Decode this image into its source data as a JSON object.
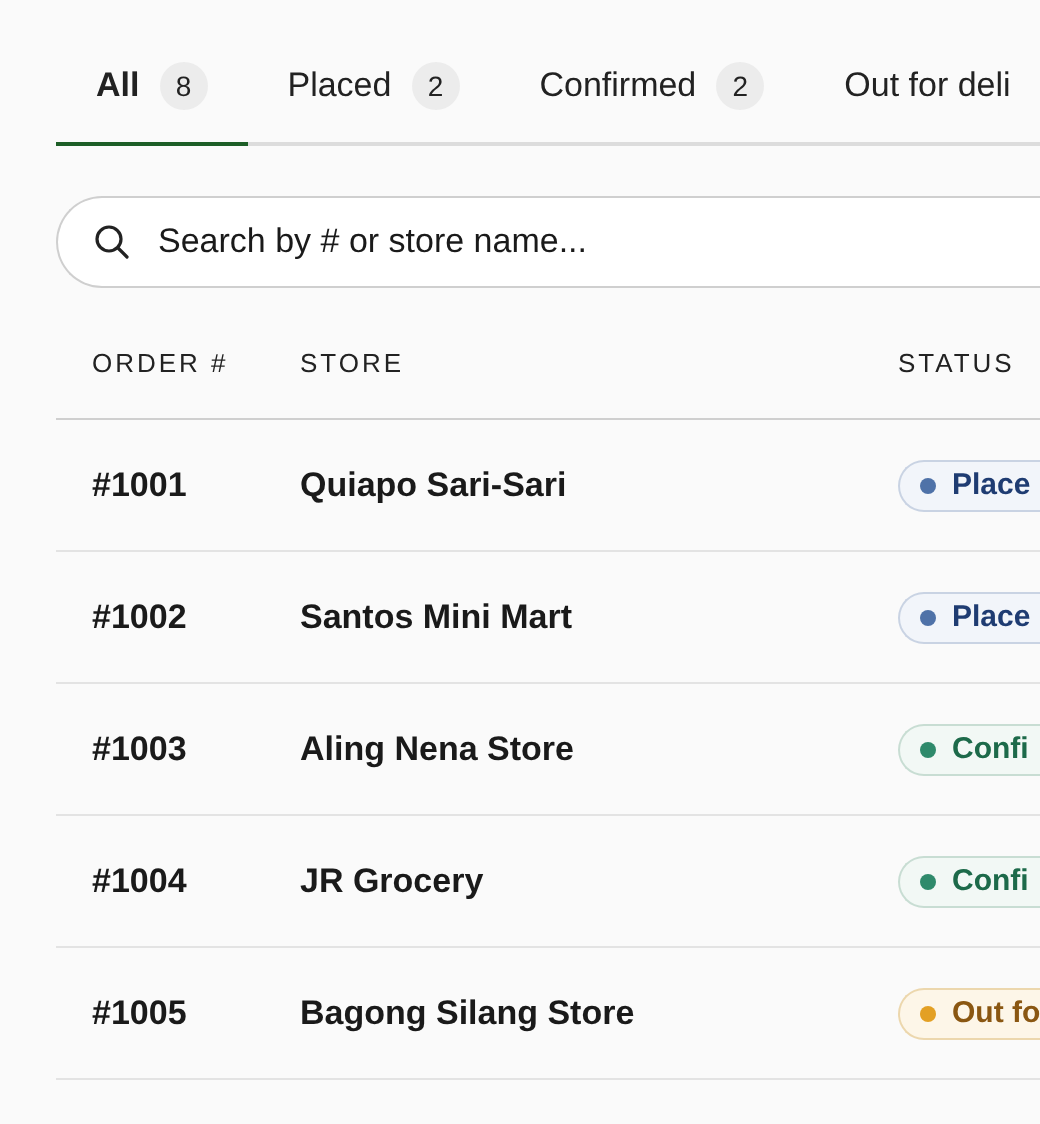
{
  "tabs": [
    {
      "label": "All",
      "count": "8",
      "selected": true
    },
    {
      "label": "Placed",
      "count": "2",
      "selected": false
    },
    {
      "label": "Confirmed",
      "count": "2",
      "selected": false
    },
    {
      "label": "Out for deli",
      "selected": false
    }
  ],
  "search": {
    "placeholder": "Search by # or store name..."
  },
  "table": {
    "columns": [
      "ORDER #",
      "STORE",
      "STATUS"
    ],
    "rows": [
      {
        "order": "#1001",
        "store": "Quiapo Sari-Sari",
        "status": {
          "label": "Place",
          "kind": "placed"
        }
      },
      {
        "order": "#1002",
        "store": "Santos Mini Mart",
        "status": {
          "label": "Place",
          "kind": "placed"
        }
      },
      {
        "order": "#1003",
        "store": "Aling Nena Store",
        "status": {
          "label": "Confi",
          "kind": "confirmed"
        }
      },
      {
        "order": "#1004",
        "store": "JR Grocery",
        "status": {
          "label": "Confi",
          "kind": "confirmed"
        }
      },
      {
        "order": "#1005",
        "store": "Bagong Silang Store",
        "status": {
          "label": "Out fo",
          "kind": "out"
        }
      }
    ]
  }
}
